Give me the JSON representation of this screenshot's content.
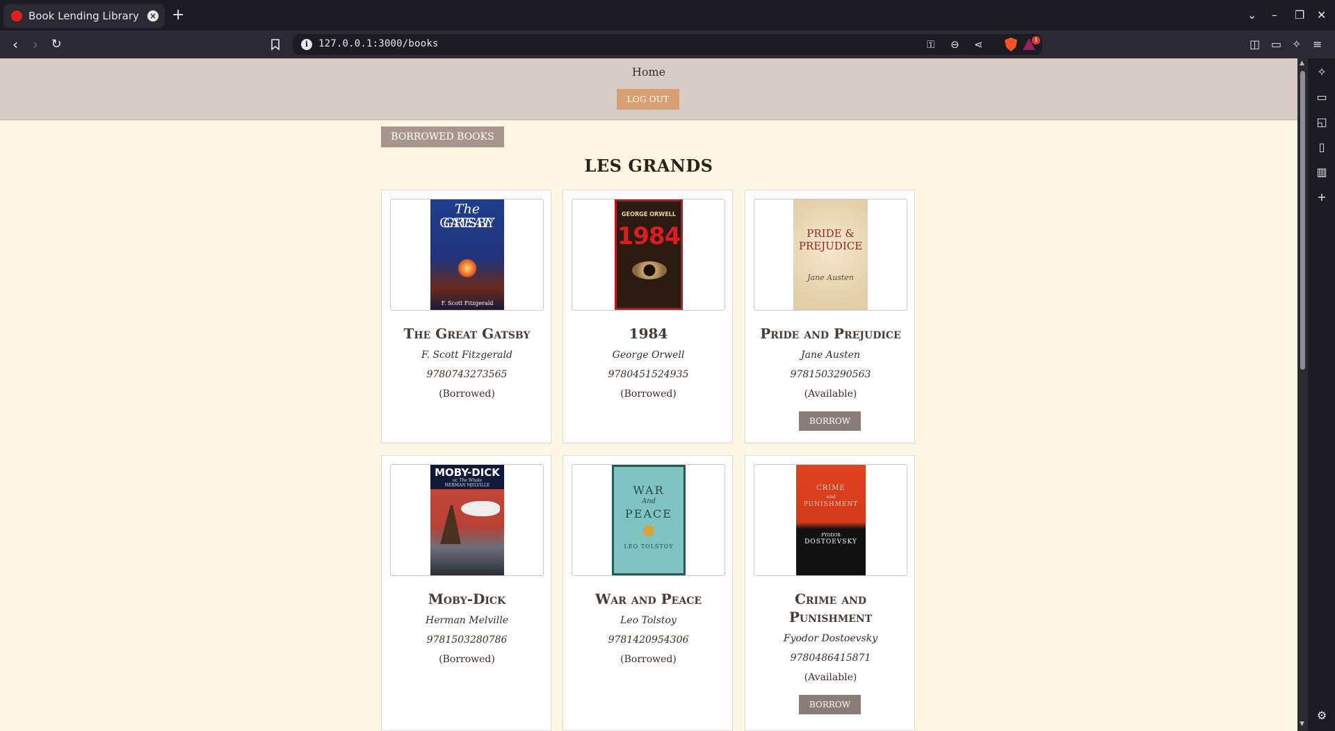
{
  "browser": {
    "tab_title": "Book Lending Library",
    "url": "127.0.0.1:3000/books",
    "rewards_badge": "1"
  },
  "header": {
    "home_link": "Home",
    "logout_label": "LOG OUT"
  },
  "main": {
    "borrowed_books_label": "BORROWED BOOKS",
    "title": "LES GRANDS",
    "books": [
      {
        "title": "The Great Gatsby",
        "author": "F. Scott Fitzgerald",
        "isbn": "9780743273565",
        "status": "(Borrowed)",
        "cover_lines": [
          "The GREAT",
          "GATSBY",
          "F. Scott Fitzgerald"
        ]
      },
      {
        "title": "1984",
        "author": "George Orwell",
        "isbn": "9780451524935",
        "status": "(Borrowed)",
        "cover_lines": [
          "GEORGE ORWELL",
          "1984"
        ]
      },
      {
        "title": "Pride and Prejudice",
        "author": "Jane Austen",
        "isbn": "9781503290563",
        "status": "(Available)",
        "borrow_label": "BORROW",
        "cover_lines": [
          "PRIDE &",
          "PREJUDICE",
          "Jane Austen"
        ]
      },
      {
        "title": "Moby-Dick",
        "author": "Herman Melville",
        "isbn": "9781503280786",
        "status": "(Borrowed)",
        "cover_lines": [
          "MOBY-DICK",
          "or, The Whale",
          "HERMAN MELVILLE"
        ]
      },
      {
        "title": "War and Peace",
        "author": "Leo Tolstoy",
        "isbn": "9781420954306",
        "status": "(Borrowed)",
        "cover_lines": [
          "WAR",
          "And",
          "PEACE",
          "LEO TOLSTOY"
        ]
      },
      {
        "title": "Crime and Punishment",
        "author": "Fyodor Dostoevsky",
        "isbn": "9780486415871",
        "status": "(Available)",
        "borrow_label": "BORROW",
        "cover_lines": [
          "CRIME",
          "and",
          "PUNISHMENT",
          "FYODOR",
          "DOSTOEVSKY"
        ]
      }
    ]
  },
  "colors": {
    "page_bg": "#fdf6e3",
    "header_bg": "#d8cdc6",
    "logout_bg": "#d9a171",
    "borrowed_btn_bg": "#a7958e",
    "borrow_btn_bg": "#8a7c76"
  },
  "icons": {
    "tab": "red-circle-favicon",
    "sidebar": [
      "leo-ai-icon",
      "video-icon",
      "wallet-icon",
      "bookmarks-icon",
      "reading-list-icon",
      "add-icon",
      "settings-icon"
    ]
  }
}
